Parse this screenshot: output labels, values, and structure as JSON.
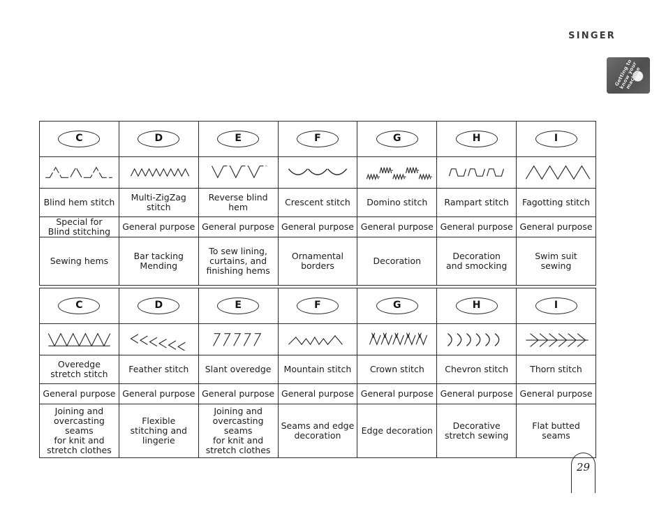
{
  "brand": {
    "name": "SINGER"
  },
  "section_tab": {
    "text_line1": "Getting to",
    "text_line2": "know your",
    "text_line3": "machine"
  },
  "page_footer": {
    "page_number": "29"
  },
  "tables": [
    {
      "id": "table-one",
      "columns": [
        {
          "letter": "C",
          "pattern": "blind-hem",
          "name": "Blind hem stitch",
          "type": "Special for\nBlind stitching",
          "use": "Sewing hems"
        },
        {
          "letter": "D",
          "pattern": "multi-zigzag",
          "name": "Multi-ZigZag\nstitch",
          "type": "General purpose",
          "use": "Bar tacking\nMending"
        },
        {
          "letter": "E",
          "pattern": "reverse-blind-hem",
          "name": "Reverse blind\nhem",
          "type": "General purpose",
          "use": "To sew lining,\ncurtains, and\nfinishing hems"
        },
        {
          "letter": "F",
          "pattern": "crescent",
          "name": "Crescent stitch",
          "type": "General purpose",
          "use": "Ornamental\nborders"
        },
        {
          "letter": "G",
          "pattern": "domino",
          "name": "Domino stitch",
          "type": "General purpose",
          "use": "Decoration"
        },
        {
          "letter": "H",
          "pattern": "rampart",
          "name": "Rampart stitch",
          "type": "General purpose",
          "use": "Decoration\nand smocking"
        },
        {
          "letter": "I",
          "pattern": "fagotting",
          "name": "Fagotting stitch",
          "type": "General purpose",
          "use": "Swim suit\nsewing"
        }
      ]
    },
    {
      "id": "table-two",
      "columns": [
        {
          "letter": "C",
          "pattern": "overedge-stretch",
          "name": "Overedge\nstretch stitch",
          "type": "General purpose",
          "use": "Joining and\novercasting seams\nfor knit and\nstretch clothes"
        },
        {
          "letter": "D",
          "pattern": "feather",
          "name": "Feather stitch",
          "type": "General purpose",
          "use": "Flexible\nstitching and\nlingerie"
        },
        {
          "letter": "E",
          "pattern": "slant-overedge",
          "name": "Slant overedge",
          "type": "General purpose",
          "use": "Joining and\novercasting seams\nfor knit and\nstretch clothes"
        },
        {
          "letter": "F",
          "pattern": "mountain",
          "name": "Mountain stitch",
          "type": "General purpose",
          "use": "Seams and edge\ndecoration"
        },
        {
          "letter": "G",
          "pattern": "crown",
          "name": "Crown stitch",
          "type": "General purpose",
          "use": "Edge decoration"
        },
        {
          "letter": "H",
          "pattern": "chevron",
          "name": "Chevron stitch",
          "type": "General purpose",
          "use": "Decorative\nstretch  sewing"
        },
        {
          "letter": "I",
          "pattern": "thorn",
          "name": "Thorn stitch",
          "type": "General purpose",
          "use": "Flat butted\nseams"
        }
      ]
    }
  ]
}
